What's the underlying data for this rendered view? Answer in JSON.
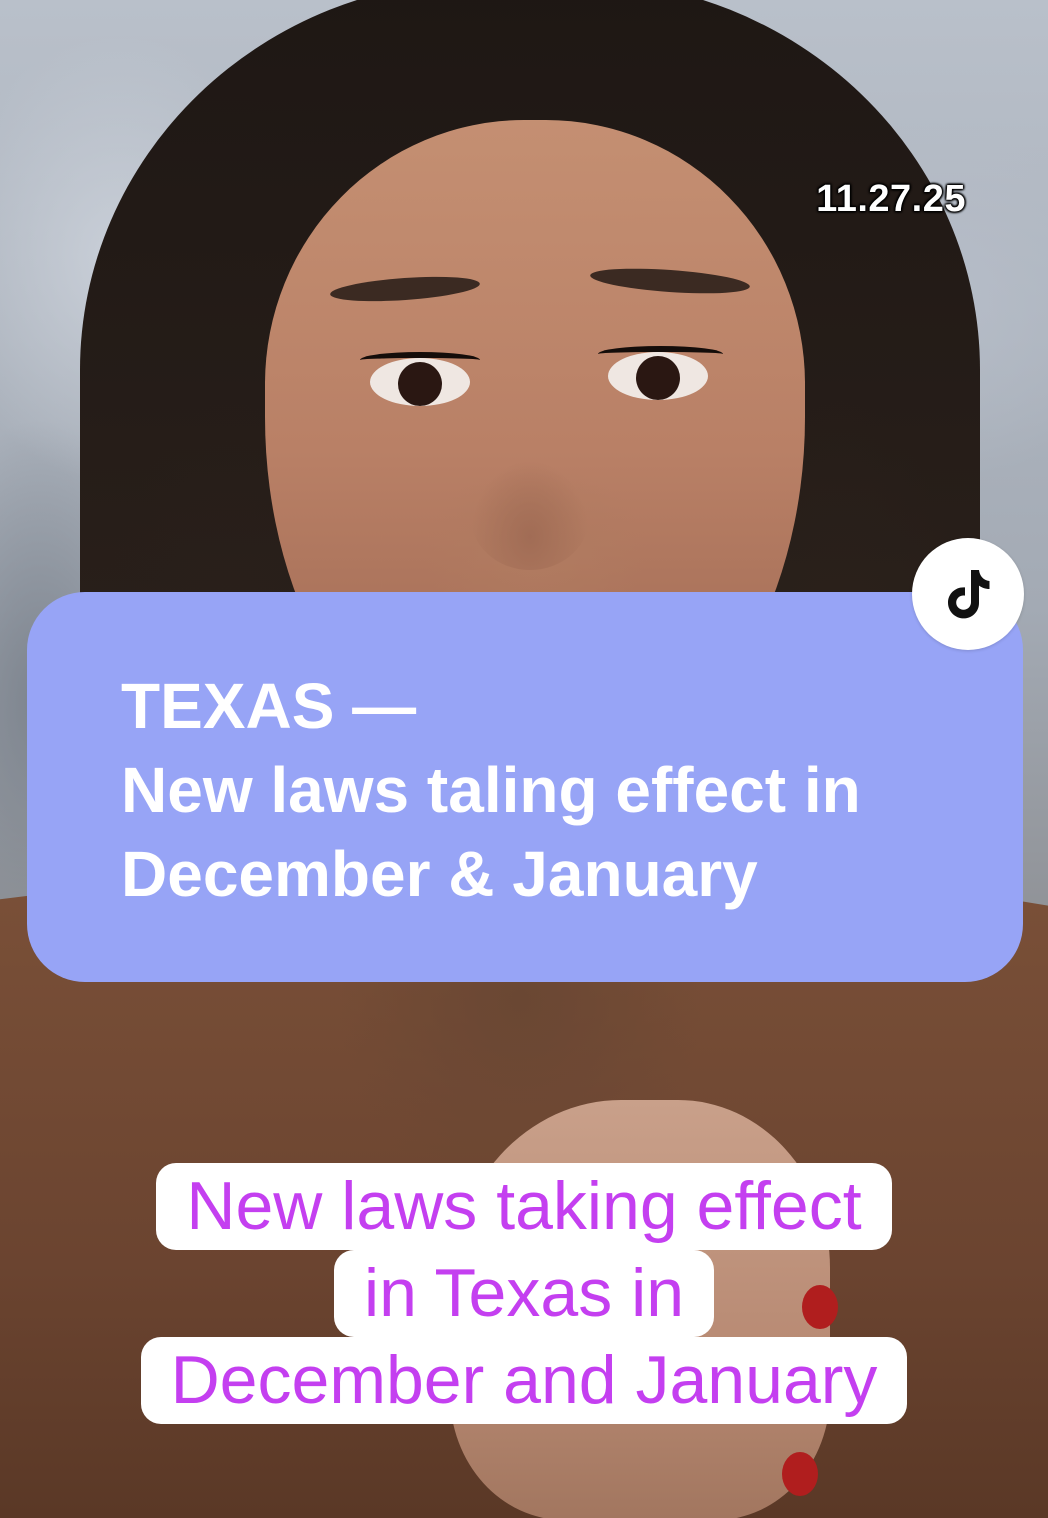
{
  "video": {
    "date_stamp": "11.27.25",
    "headline": {
      "lines": [
        "TEXAS —",
        "New laws taling effect in",
        "December & January"
      ],
      "background_color": "#97a4f6",
      "text_color": "#ffffff"
    },
    "caption": {
      "lines": [
        "New laws taking effect",
        "in Texas in",
        "December and January"
      ],
      "background_color": "#ffffff",
      "text_color": "#c43ff0"
    },
    "watermark_icon": "tiktok-logo-icon"
  }
}
